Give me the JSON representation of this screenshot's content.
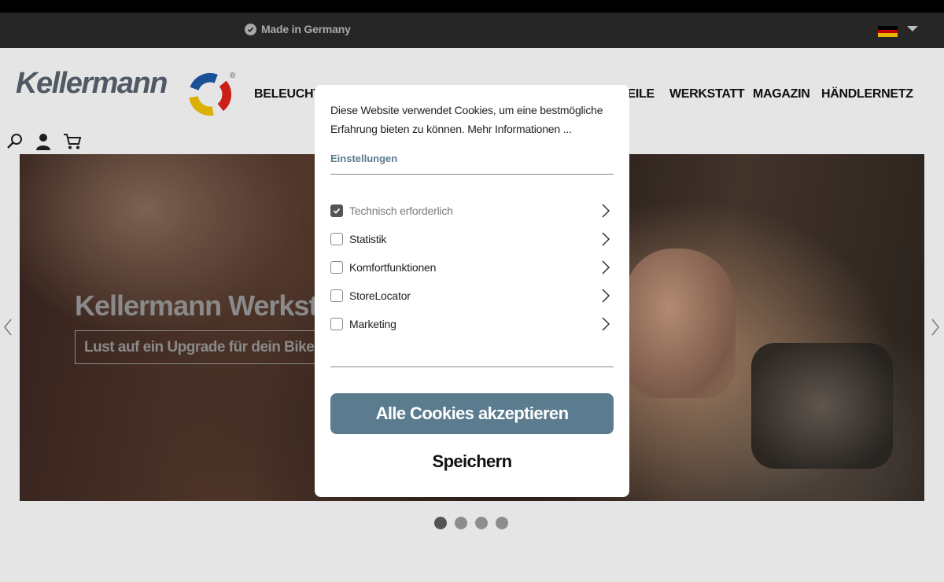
{
  "topbar": {
    "made_in": "Made in Germany",
    "flag_colors": [
      "#000000",
      "#dd0000",
      "#ffce00"
    ]
  },
  "header": {
    "logo_text": "Kellermann",
    "logo_reg": "®",
    "nav": [
      {
        "label": "BELEUCHTU"
      },
      {
        "label": "TEILE"
      },
      {
        "label": "WERKSTATT"
      },
      {
        "label": "MAGAZIN"
      },
      {
        "label": "HÄNDLERNETZ"
      }
    ]
  },
  "hero": {
    "title": "Kellermann Werkstatt",
    "button": "Lust auf ein Upgrade für dein Bike?"
  },
  "slider": {
    "dots": 4,
    "active": 0
  },
  "cookie_modal": {
    "text": "Diese Website verwendet Cookies, um eine bestmögliche Erfahrung bieten zu können. Mehr Informationen ...",
    "settings_label": "Einstellungen",
    "options": [
      {
        "label": "Technisch erforderlich",
        "checked": true
      },
      {
        "label": "Statistik",
        "checked": false
      },
      {
        "label": "Komfortfunktionen",
        "checked": false
      },
      {
        "label": "StoreLocator",
        "checked": false
      },
      {
        "label": "Marketing",
        "checked": false
      }
    ],
    "accept_all": "Alle Cookies akzeptieren",
    "save": "Speichern"
  },
  "colors": {
    "accent": "#5b7b8e",
    "topbar_bg": "#2b2b2b"
  }
}
